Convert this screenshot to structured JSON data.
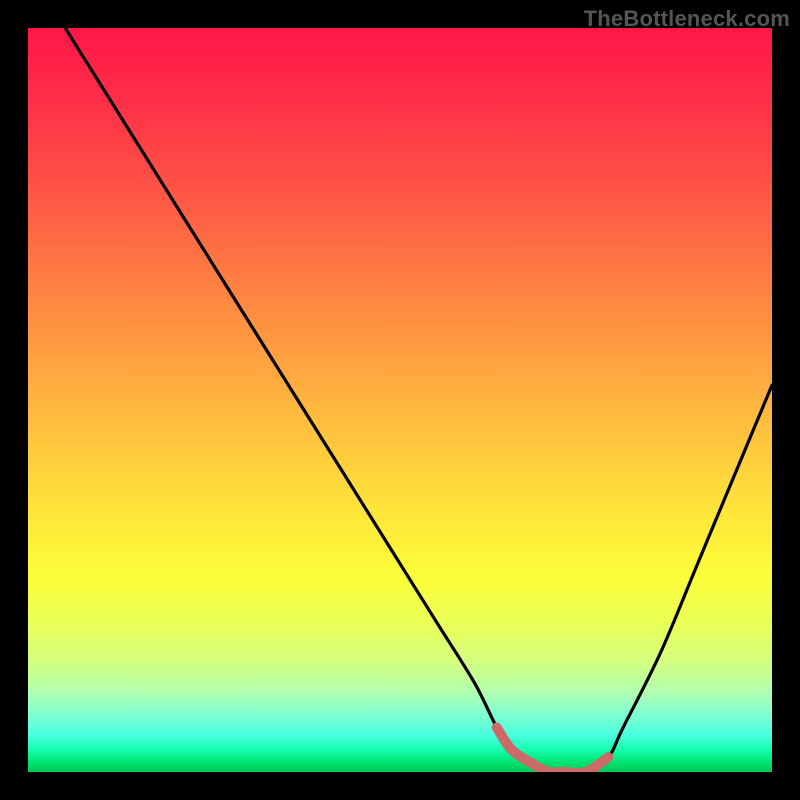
{
  "watermark": "TheBottleneck.com",
  "chart_data": {
    "type": "line",
    "title": "",
    "xlabel": "",
    "ylabel": "",
    "xlim": [
      0,
      100
    ],
    "ylim": [
      0,
      100
    ],
    "grid": false,
    "legend": false,
    "series": [
      {
        "name": "bottleneck-curve",
        "x": [
          5,
          10,
          15,
          20,
          25,
          30,
          35,
          40,
          45,
          50,
          55,
          60,
          63,
          65,
          68,
          70,
          72,
          75,
          78,
          80,
          85,
          90,
          95,
          100
        ],
        "values": [
          100,
          92,
          84,
          76,
          68,
          60,
          52,
          44,
          36,
          28,
          20,
          12,
          6,
          3,
          1,
          0,
          0,
          0,
          2,
          6,
          16,
          28,
          40,
          52
        ]
      }
    ],
    "optimal_marker": {
      "name": "optimal-range",
      "x": [
        63,
        65,
        68,
        70,
        72,
        75,
        78
      ],
      "values": [
        6,
        3,
        1,
        0,
        0,
        0,
        2
      ]
    },
    "background": {
      "type": "vertical-gradient",
      "stops": [
        {
          "pos": 0.0,
          "color": "#ff1648"
        },
        {
          "pos": 0.45,
          "color": "#ff9b40"
        },
        {
          "pos": 0.7,
          "color": "#fff638"
        },
        {
          "pos": 0.9,
          "color": "#a4ffb8"
        },
        {
          "pos": 1.0,
          "color": "#00c853"
        }
      ]
    }
  }
}
